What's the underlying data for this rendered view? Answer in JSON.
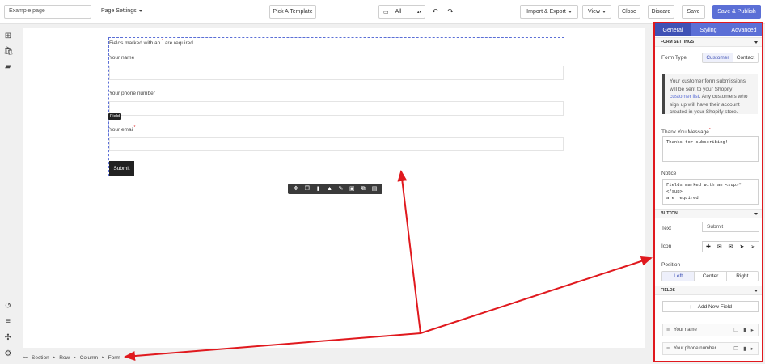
{
  "topbar": {
    "page_name": "Example page",
    "page_settings": "Page Settings",
    "pick_template": "Pick A Template",
    "device": "All",
    "import_export": "Import & Export",
    "view": "View",
    "close": "Close",
    "discard": "Discard",
    "save": "Save",
    "save_publish": "Save & Publish"
  },
  "canvas": {
    "form_note": "Fields marked with an",
    "form_note_star": "*",
    "form_note_tail": "are required",
    "fields": [
      {
        "label": "Your name",
        "required": ""
      },
      {
        "label": "Your phone number",
        "required": ""
      },
      {
        "label": "Your email",
        "required": "*"
      }
    ],
    "field_tag": "Field",
    "submit": "Submit"
  },
  "breadcrumb": [
    "Section",
    "Row",
    "Column",
    "Form"
  ],
  "panel": {
    "tabs": [
      "General",
      "Styling",
      "Advanced"
    ],
    "form_settings": "FORM SETTINGS",
    "form_type_label": "Form Type",
    "form_type_options": [
      "Customer",
      "Contact"
    ],
    "info": {
      "part1": "Your customer form submissions will be sent to your Shopify",
      "link": "customer list",
      "part2": ". Any customers who sign up will have their account created in your Shopify store."
    },
    "thank_you_label": "Thank You Message",
    "thank_you_value": "Thanks for subscribing!",
    "notice_label": "Notice",
    "notice_value": "Fields marked with an <sup>*</sup>\nare required",
    "button_head": "BUTTON",
    "text_label": "Text",
    "text_value": "Submit",
    "icon_label": "Icon",
    "position_label": "Position",
    "position_options": [
      "Left",
      "Center",
      "Right"
    ],
    "fields_head": "FIELDS",
    "add_field": "Add New Field",
    "field_list": [
      "Your name",
      "Your phone number"
    ]
  },
  "colors": {
    "accent": "#5b6fd6",
    "tab_active": "#3f51b5",
    "annotation": "#e0191e"
  }
}
